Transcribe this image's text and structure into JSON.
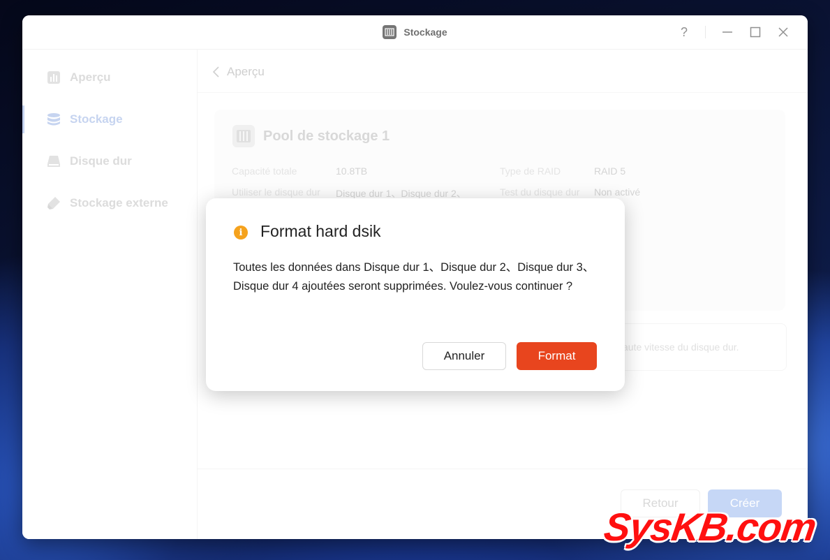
{
  "window": {
    "title": "Stockage",
    "help_glyph": "?",
    "icons": [
      "app-storage-icon",
      "help-icon",
      "minimize-icon",
      "maximize-icon",
      "close-icon"
    ]
  },
  "sidebar": {
    "items": [
      {
        "label": "Aperçu",
        "icon": "overview-icon",
        "active": false
      },
      {
        "label": "Stockage",
        "icon": "database-icon",
        "active": true
      },
      {
        "label": "Disque dur",
        "icon": "hard-disk-icon",
        "active": false
      },
      {
        "label": "Stockage externe",
        "icon": "external-drive-icon",
        "active": false
      }
    ]
  },
  "main": {
    "breadcrumb": "Aperçu",
    "pool": {
      "title": "Pool de stockage 1",
      "fields": [
        {
          "key": "Capacité totale",
          "value": "10.8TB"
        },
        {
          "key": "Type de RAID",
          "value": "RAID 5"
        },
        {
          "key": "Utiliser le disque dur",
          "value": "Disque dur 1、Disque dur 2、"
        },
        {
          "key": "Test du disque dur",
          "value": "Non activé"
        }
      ]
    },
    "note": "aute vitesse du disque dur.",
    "footer": {
      "back_label": "Retour",
      "create_label": "Créer"
    }
  },
  "dialog": {
    "title": "Format hard dsik",
    "message": "Toutes les données dans Disque dur 1、Disque dur 2、Disque dur 3、Disque dur 4 ajoutées seront supprimées. Voulez-vous continuer ?",
    "cancel_label": "Annuler",
    "confirm_label": "Format",
    "info_glyph": "i"
  },
  "colors": {
    "accent": "#e8451e",
    "warning": "#f5a21d",
    "primary_disabled": "#a8c2f2"
  },
  "watermark": "SysKB.com"
}
